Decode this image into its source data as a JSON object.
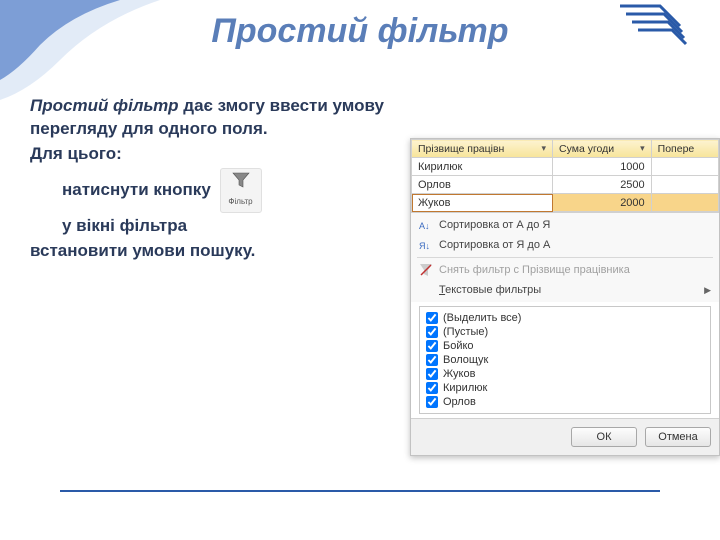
{
  "slide": {
    "title": "Простий фільтр",
    "p1_em": "Простий фільтр",
    "p1_rest": " дає змогу ввести умову перегляду для одного поля.",
    "p2": "Для цього:",
    "p3": "натиснути кнопку",
    "p4": "у вікні фільтра",
    "p5": "встановити умови пошуку.",
    "filter_btn_label": "Фільтр"
  },
  "table": {
    "headers": [
      "Прізвище працівн",
      "Сума угоди",
      "Попере"
    ],
    "rows": [
      {
        "c0": "Кирилюк",
        "c1": "1000",
        "c2": ""
      },
      {
        "c0": "Орлов",
        "c1": "2500",
        "c2": ""
      },
      {
        "c0": "Жуков",
        "c1": "2000",
        "c2": ""
      }
    ]
  },
  "menu": {
    "sort_asc": "Сортировка от А до Я",
    "sort_desc": "Сортировка от Я до А",
    "clear_filter": "Снять фильтр с Прізвище працівника",
    "text_filters": "Текстовые фильтры"
  },
  "checks": {
    "items": [
      "(Выделить все)",
      "(Пустые)",
      "Бойко",
      "Волощук",
      "Жуков",
      "Кирилюк",
      "Орлов"
    ]
  },
  "buttons": {
    "ok": "ОК",
    "cancel": "Отмена"
  }
}
